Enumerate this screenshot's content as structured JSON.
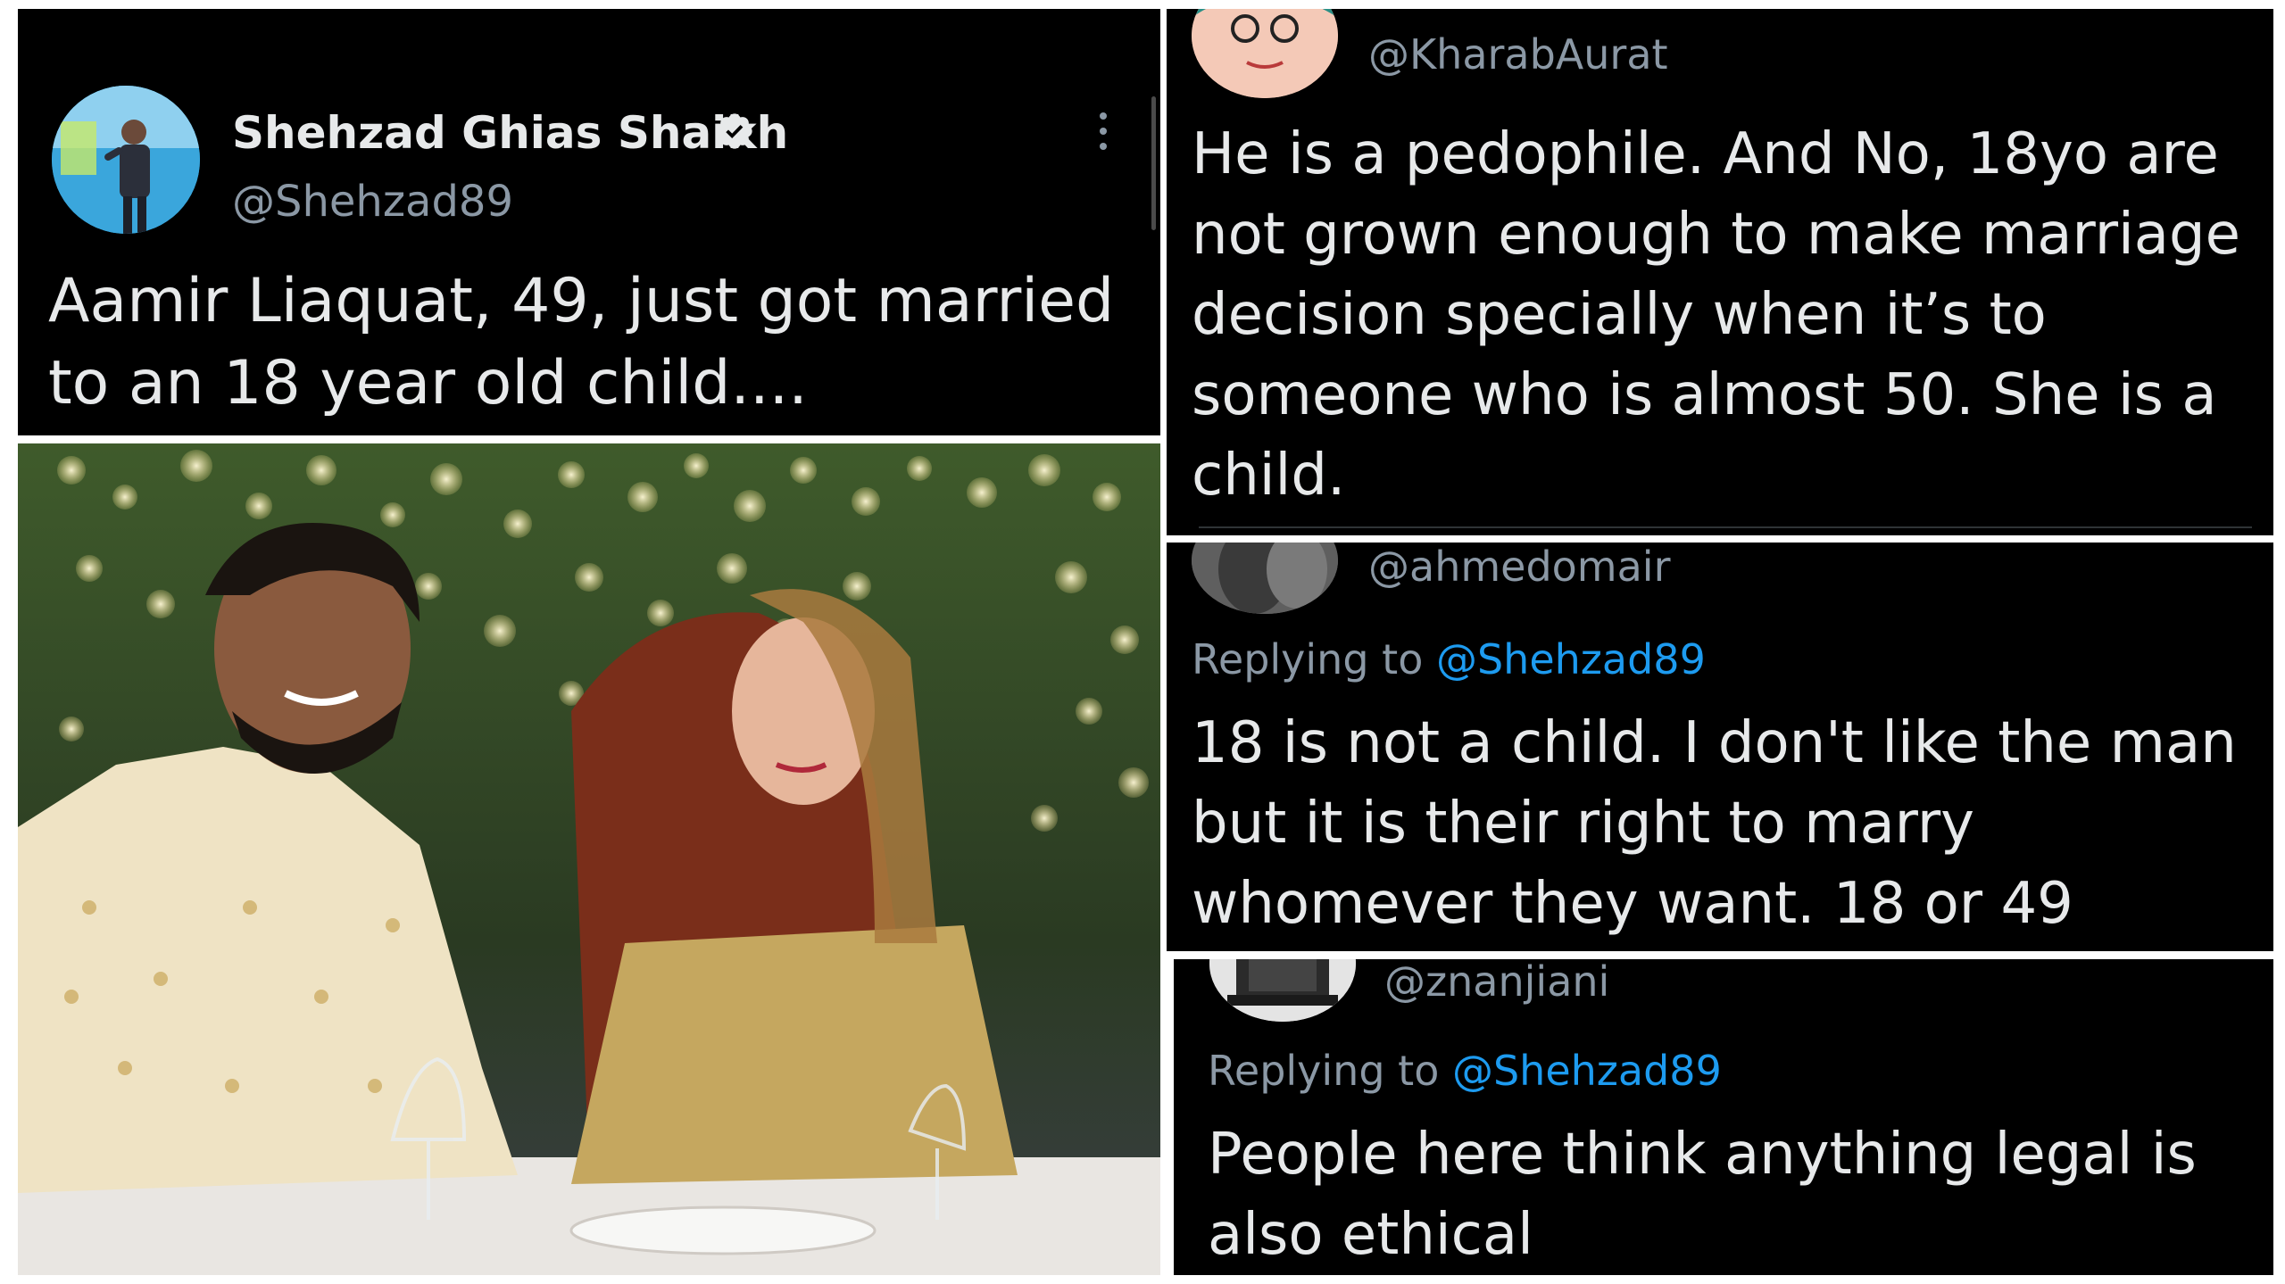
{
  "main_tweet": {
    "author_name": "Shehzad Ghias Shaikh",
    "handle": "@Shehzad89",
    "text": "Aamir Liaquat, 49, just got married to an 18 year old child....",
    "icons": [
      "verified-badge-icon",
      "more-options-icon"
    ]
  },
  "photo": {
    "description_icon": "wedding-photo"
  },
  "replies": [
    {
      "handle": "@KharabAurat",
      "text": "He is a pedophile. And No, 18yo are not grown enough to make marriage decision specially when it’s to someone who is almost 50. She is a child."
    },
    {
      "handle": "@ahmedomair",
      "replying_prefix": "Replying to",
      "replying_to": "@Shehzad89",
      "text": "18 is not a child. I don't like the man but it is their right to marry whomever they want. 18 or 49"
    },
    {
      "handle": "@znanjiani",
      "replying_prefix": "Replying to",
      "replying_to": "@Shehzad89",
      "text": "People here think anything legal is also ethical"
    }
  ],
  "colors": {
    "panel_bg": "#000000",
    "text": "#e7e9ea",
    "secondary": "#8b98a5",
    "link": "#1d9bf0",
    "verified": "#e7e9ea"
  }
}
